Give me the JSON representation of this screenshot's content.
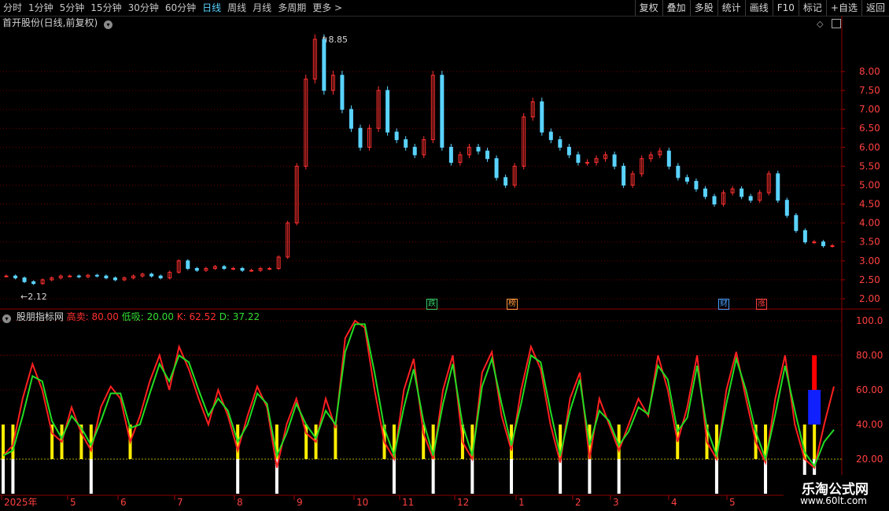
{
  "toolbar": {
    "periods": [
      "分时",
      "1分钟",
      "5分钟",
      "15分钟",
      "30分钟",
      "60分钟",
      "日线",
      "周线",
      "月线",
      "多周期",
      "更多 >"
    ],
    "active_period": "日线",
    "tools": [
      "复权",
      "叠加",
      "多股",
      "统计",
      "画线",
      "F10",
      "标记",
      "+自选",
      "返回"
    ]
  },
  "main_chart": {
    "title": "首开股份(日线,前复权)",
    "high_label": "8.85",
    "low_label": "2.12",
    "y_ticks": [
      "8.00",
      "7.50",
      "7.00",
      "6.50",
      "6.00",
      "5.50",
      "5.00",
      "4.50",
      "4.00",
      "3.50",
      "3.00",
      "2.50",
      "2.00"
    ],
    "markers": [
      {
        "text": "跌",
        "color": "#33cc66"
      },
      {
        "text": "榜",
        "color": "#ff9a40"
      },
      {
        "text": "财",
        "color": "#4aa0ff"
      },
      {
        "text": "涨",
        "color": "#ff4040"
      }
    ]
  },
  "indicator": {
    "name": "股朋指标网",
    "high_label": "高卖: 80.00",
    "low_label": "低吸: 20.00",
    "k_label": "K: 62.52",
    "d_label": "D: 37.22",
    "y_ticks": [
      "100.0",
      "80.00",
      "60.00",
      "40.00",
      "20.00"
    ]
  },
  "x_axis": [
    "2025年",
    "5",
    "6",
    "7",
    "8",
    "9",
    "10",
    "11",
    "12",
    "1",
    "2",
    "3",
    "4",
    "5"
  ],
  "watermark": {
    "line1": "乐淘公式网",
    "line2": "www.60lt.com"
  },
  "colors": {
    "up": "#ff3030",
    "down": "#5ad3ff",
    "k": "#ff2020",
    "d": "#22dd22",
    "grid": "#6a0000",
    "bg": "#000000"
  },
  "chart_data": {
    "type": "line",
    "title": "首开股份(日线,前复权)",
    "x": [
      "2025年",
      "5",
      "6",
      "7",
      "8",
      "9",
      "10",
      "11",
      "12",
      "1",
      "2",
      "3",
      "4",
      "5"
    ],
    "series": [
      {
        "values": [
          2.6,
          2.55,
          2.45,
          2.4,
          2.5,
          2.55,
          2.6,
          2.6,
          2.58,
          2.62,
          2.6,
          2.55,
          2.5,
          2.55,
          2.6,
          2.65,
          2.6,
          2.55,
          2.7,
          3.0,
          2.8,
          2.75,
          2.8,
          2.85,
          2.8,
          2.8,
          2.75,
          2.75,
          2.8,
          2.8,
          3.1,
          4.0,
          5.5,
          7.8,
          8.85,
          7.5,
          7.9,
          7.0,
          6.5,
          6.0,
          6.5,
          7.5,
          6.4,
          6.2,
          6.0,
          5.8,
          6.2,
          7.9,
          6.0,
          5.6,
          5.8,
          6.0,
          5.9,
          5.7,
          5.2,
          5.0,
          5.5,
          6.8,
          7.2,
          6.4,
          6.2,
          6.0,
          5.8,
          5.6,
          5.6,
          5.7,
          5.8,
          5.5,
          5.0,
          5.3,
          5.7,
          5.8,
          5.9,
          5.5,
          5.2,
          5.1,
          4.9,
          4.7,
          4.5,
          4.8,
          4.9,
          4.7,
          4.6,
          4.8,
          5.3,
          4.6,
          4.2,
          3.8,
          3.5,
          3.5,
          3.4,
          3.4
        ]
      },
      {
        "name": "K",
        "values": [
          22,
          28,
          55,
          75,
          60,
          35,
          30,
          50,
          35,
          25,
          50,
          62,
          55,
          30,
          45,
          65,
          80,
          60,
          85,
          72,
          55,
          40,
          60,
          45,
          25,
          45,
          62,
          50,
          15,
          40,
          55,
          35,
          30,
          55,
          38,
          90,
          100,
          96,
          60,
          30,
          20,
          60,
          78,
          35,
          20,
          60,
          80,
          30,
          20,
          70,
          82,
          45,
          25,
          60,
          85,
          72,
          40,
          18,
          55,
          70,
          20,
          55,
          40,
          25,
          40,
          55,
          45,
          80,
          60,
          30,
          50,
          80,
          30,
          20,
          60,
          82,
          55,
          30,
          18,
          55,
          80,
          40,
          20,
          15,
          40,
          62
        ]
      },
      {
        "name": "D",
        "values": [
          22,
          25,
          45,
          68,
          65,
          42,
          32,
          45,
          38,
          28,
          42,
          58,
          58,
          38,
          40,
          58,
          75,
          65,
          80,
          76,
          60,
          45,
          55,
          48,
          30,
          40,
          58,
          52,
          22,
          35,
          52,
          40,
          32,
          48,
          40,
          82,
          98,
          98,
          70,
          38,
          22,
          50,
          72,
          42,
          22,
          52,
          75,
          40,
          22,
          62,
          78,
          52,
          28,
          52,
          80,
          76,
          48,
          22,
          48,
          66,
          28,
          48,
          42,
          28,
          36,
          50,
          46,
          74,
          66,
          36,
          44,
          74,
          38,
          22,
          52,
          78,
          60,
          36,
          20,
          46,
          74,
          48,
          24,
          16,
          30,
          37
        ]
      }
    ],
    "ylim": [
      2.0,
      8.85
    ],
    "indicator_ylim": [
      0,
      100
    ],
    "hlines": [
      80,
      20
    ]
  }
}
